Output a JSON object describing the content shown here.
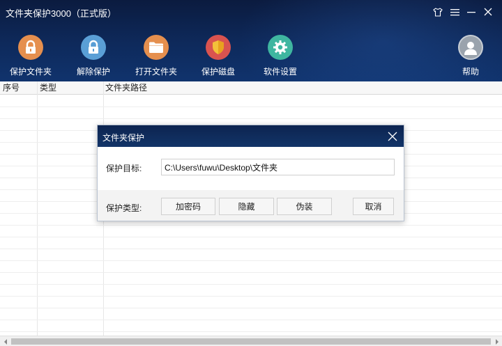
{
  "app": {
    "title": "文件夹保护3000（正式版）"
  },
  "window_controls": {
    "skin_icon": "tshirt-icon",
    "menu_icon": "hamburger-menu-icon",
    "minimize_icon": "minimize-icon",
    "close_icon": "close-icon"
  },
  "toolbar": {
    "items": [
      {
        "label": "保护文件夹",
        "icon": "lock-icon",
        "color": "#e58f4e"
      },
      {
        "label": "解除保护",
        "icon": "unlock-icon",
        "color": "#5a9fd6"
      },
      {
        "label": "打开文件夹",
        "icon": "folder-icon",
        "color": "#e58f4e"
      },
      {
        "label": "保护磁盘",
        "icon": "shield-icon",
        "color": "#d9534f"
      },
      {
        "label": "软件设置",
        "icon": "gear-icon",
        "color": "#3fb6a0"
      }
    ],
    "help": {
      "label": "帮助",
      "icon": "user-avatar-icon",
      "color": "#9aa3ad"
    }
  },
  "table": {
    "columns": [
      "序号",
      "类型",
      "文件夹路径"
    ],
    "rows": []
  },
  "dialog": {
    "title": "文件夹保护",
    "target_label": "保护目标:",
    "target_value": "C:\\Users\\fuwu\\Desktop\\文件夹",
    "type_label": "保护类型:",
    "buttons": {
      "encrypt": "加密码",
      "hide": "隐藏",
      "disguise": "伪装",
      "cancel": "取消"
    }
  }
}
